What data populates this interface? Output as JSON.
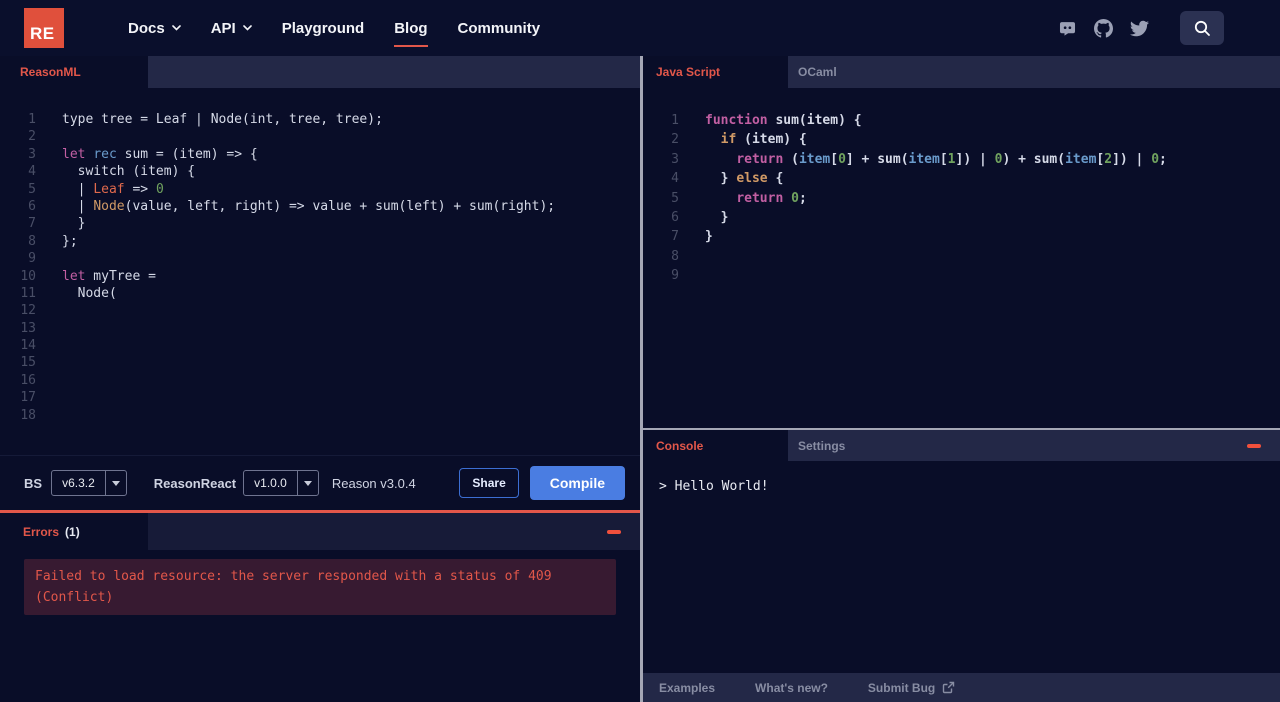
{
  "colors": {
    "accent_red": "#e2574a",
    "logo_red": "#e0503c",
    "compile_blue": "#4a7de2",
    "background_navy": "#090d28"
  },
  "navbar": {
    "logo_text": "RE",
    "items": [
      {
        "label": "Docs",
        "chevron": true,
        "active": false
      },
      {
        "label": "API",
        "chevron": true,
        "active": false
      },
      {
        "label": "Playground",
        "chevron": false,
        "active": false
      },
      {
        "label": "Blog",
        "chevron": false,
        "active": true
      },
      {
        "label": "Community",
        "chevron": false,
        "active": false
      }
    ],
    "social_icons": [
      "discord",
      "github",
      "twitter"
    ],
    "search_icon": "search"
  },
  "left_pane": {
    "tab": "ReasonML",
    "editor": {
      "language": "reason",
      "lines": [
        [
          [
            "p",
            "type tree = Leaf | Node(int, tree, tree);"
          ]
        ],
        [],
        [
          [
            "k",
            "let"
          ],
          [
            "p",
            " "
          ],
          [
            "b",
            "rec"
          ],
          [
            "p",
            " sum = (item) => {"
          ]
        ],
        [
          [
            "p",
            "  switch (item) {"
          ]
        ],
        [
          [
            "p",
            "  | "
          ],
          [
            "r",
            "Leaf"
          ],
          [
            "p",
            " => "
          ],
          [
            "g",
            "0"
          ]
        ],
        [
          [
            "p",
            "  | "
          ],
          [
            "o",
            "Node"
          ],
          [
            "p",
            "(value, left, right) => value + sum(left) + sum(right);"
          ]
        ],
        [
          [
            "p",
            "  }"
          ]
        ],
        [
          [
            "p",
            "};"
          ]
        ],
        [],
        [
          [
            "k",
            "let"
          ],
          [
            "p",
            " myTree ="
          ]
        ],
        [
          [
            "p",
            "  Node("
          ]
        ],
        [],
        [],
        [],
        [],
        [],
        [],
        []
      ]
    },
    "toolbar": {
      "bs_label": "BS",
      "bs_version": "v6.3.2",
      "reasonreact_label": "ReasonReact",
      "reasonreact_version": "v1.0.0",
      "reason_version": "Reason v3.0.4",
      "share_label": "Share",
      "compile_label": "Compile"
    },
    "errors": {
      "title": "Errors",
      "count": "(1)",
      "message_line1": "Failed to load resource: the server responded with a status of 409",
      "message_line2": "(Conflict)"
    }
  },
  "right_pane": {
    "tabs": [
      {
        "label": "Java Script",
        "active": true
      },
      {
        "label": "OCaml",
        "active": false
      }
    ],
    "editor": {
      "language": "javascript",
      "lines": [
        [
          [
            "k",
            "function"
          ],
          [
            "p",
            " sum(item) {"
          ]
        ],
        [
          [
            "p",
            "  "
          ],
          [
            "o",
            "if"
          ],
          [
            "p",
            " (item) {"
          ]
        ],
        [
          [
            "p",
            "    "
          ],
          [
            "k",
            "return"
          ],
          [
            "p",
            " ("
          ],
          [
            "b",
            "item"
          ],
          [
            "p",
            "["
          ],
          [
            "g",
            "0"
          ],
          [
            "p",
            "] + sum("
          ],
          [
            "b",
            "item"
          ],
          [
            "p",
            "["
          ],
          [
            "g",
            "1"
          ],
          [
            "p",
            "]) | "
          ],
          [
            "g",
            "0"
          ],
          [
            "p",
            ") + sum("
          ],
          [
            "b",
            "item"
          ],
          [
            "p",
            "["
          ],
          [
            "g",
            "2"
          ],
          [
            "p",
            "]) | "
          ],
          [
            "g",
            "0"
          ],
          [
            "p",
            ";"
          ]
        ],
        [
          [
            "p",
            "  } "
          ],
          [
            "o",
            "else"
          ],
          [
            "p",
            " {"
          ]
        ],
        [
          [
            "p",
            "    "
          ],
          [
            "k",
            "return"
          ],
          [
            "p",
            " "
          ],
          [
            "g",
            "0"
          ],
          [
            "p",
            ";"
          ]
        ],
        [
          [
            "p",
            "  }"
          ]
        ],
        [
          [
            "p",
            "}"
          ]
        ],
        [],
        []
      ]
    },
    "console": {
      "tabs": [
        {
          "label": "Console",
          "active": true
        },
        {
          "label": "Settings",
          "active": false
        }
      ],
      "output": "> Hello World!"
    },
    "footer": {
      "links": [
        "Examples",
        "What's new?",
        "Submit Bug"
      ]
    }
  }
}
